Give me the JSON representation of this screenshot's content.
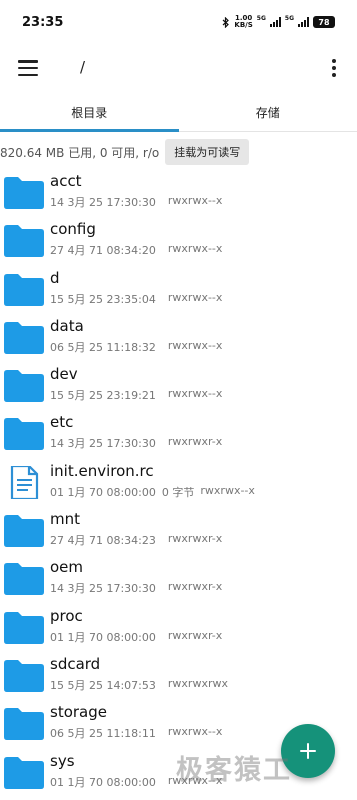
{
  "status_bar": {
    "time": "23:35",
    "speed_top": "1.00",
    "speed_unit": "KB/S",
    "net1": "5G",
    "net2": "5G",
    "battery": "78",
    "icons": [
      "bluetooth-icon",
      "signal-icon",
      "signal-icon",
      "battery-icon"
    ]
  },
  "app_bar": {
    "title": "/",
    "icons": [
      "menu-icon",
      "more-vert-icon"
    ]
  },
  "tabs": [
    {
      "label": "根目录",
      "active": true
    },
    {
      "label": "存储",
      "active": false
    }
  ],
  "info": {
    "text": "820.64 MB 已用, 0 可用, r/o",
    "mount_button": "挂载为可读写"
  },
  "files": [
    {
      "name": "acct",
      "date": "14 3月 25 17:30:30",
      "size": "",
      "perms": "rwxrwx--x",
      "type": "folder"
    },
    {
      "name": "config",
      "date": "27 4月 71 08:34:20",
      "size": "",
      "perms": "rwxrwx--x",
      "type": "folder"
    },
    {
      "name": "d",
      "date": "15 5月 25 23:35:04",
      "size": "",
      "perms": "rwxrwx--x",
      "type": "folder"
    },
    {
      "name": "data",
      "date": "06 5月 25 11:18:32",
      "size": "",
      "perms": "rwxrwx--x",
      "type": "folder"
    },
    {
      "name": "dev",
      "date": "15 5月 25 23:19:21",
      "size": "",
      "perms": "rwxrwx--x",
      "type": "folder"
    },
    {
      "name": "etc",
      "date": "14 3月 25 17:30:30",
      "size": "",
      "perms": "rwxrwxr-x",
      "type": "folder"
    },
    {
      "name": "init.environ.rc",
      "date": "01 1月 70 08:00:00",
      "size": "0 字节",
      "perms": "rwxrwx--x",
      "type": "file"
    },
    {
      "name": "mnt",
      "date": "27 4月 71 08:34:23",
      "size": "",
      "perms": "rwxrwxr-x",
      "type": "folder"
    },
    {
      "name": "oem",
      "date": "14 3月 25 17:30:30",
      "size": "",
      "perms": "rwxrwxr-x",
      "type": "folder"
    },
    {
      "name": "proc",
      "date": "01 1月 70 08:00:00",
      "size": "",
      "perms": "rwxrwxr-x",
      "type": "folder"
    },
    {
      "name": "sdcard",
      "date": "15 5月 25 14:07:53",
      "size": "",
      "perms": "rwxrwxrwx",
      "type": "folder"
    },
    {
      "name": "storage",
      "date": "06 5月 25 11:18:11",
      "size": "",
      "perms": "rwxrwx--x",
      "type": "folder"
    },
    {
      "name": "sys",
      "date": "01 1月 70 08:00:00",
      "size": "",
      "perms": "rwxrwx--x",
      "type": "folder"
    }
  ],
  "fab": {
    "icon": "add-icon",
    "color": "#15927a"
  },
  "watermark": "极客猿工",
  "colors": {
    "accent": "#2a8fc7",
    "folder": "#1e9be6",
    "file": "#2d8fd5"
  }
}
